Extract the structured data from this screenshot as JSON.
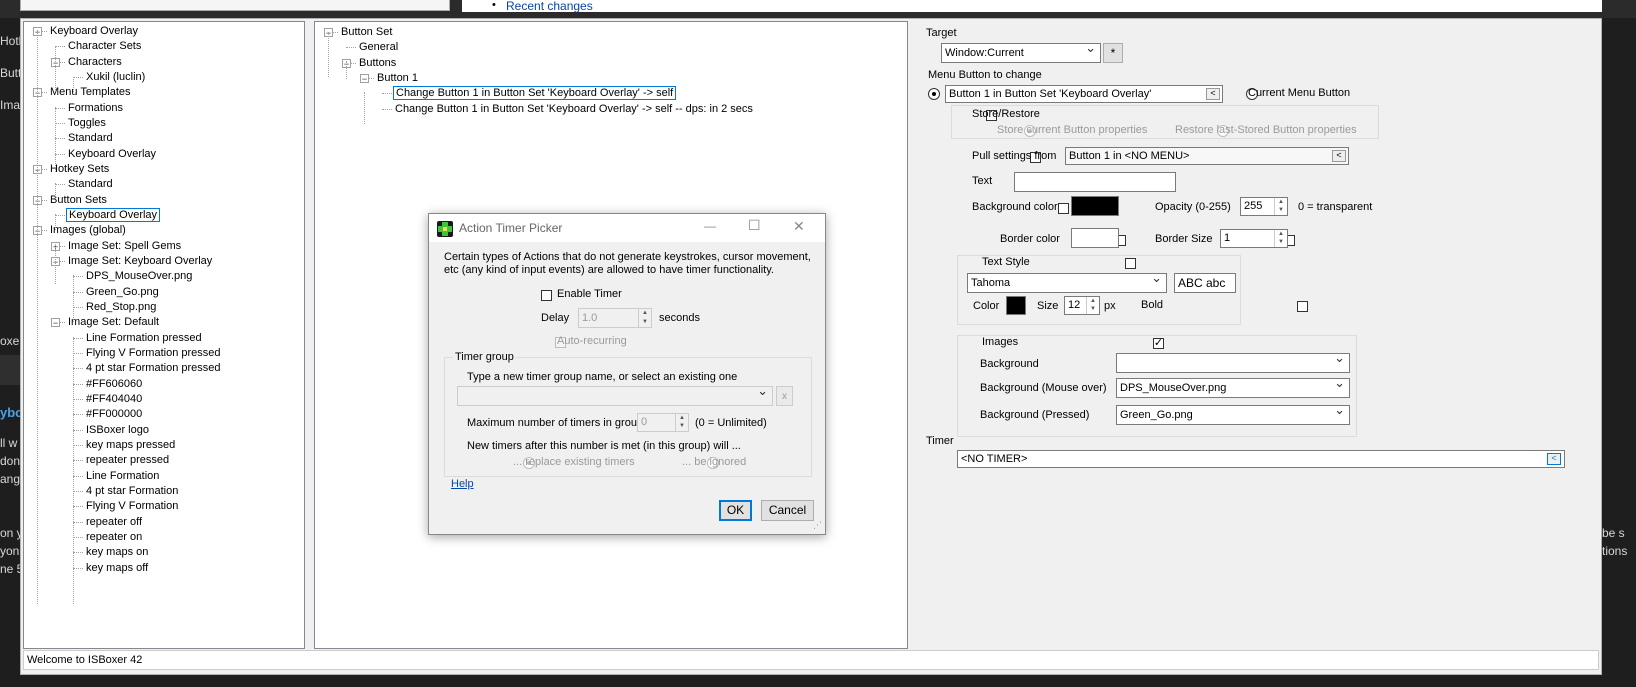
{
  "background": {
    "top_link": "Recent changes",
    "left_fragments": [
      "Hotk",
      "Butt",
      "Imag",
      "oxe",
      "ybo",
      "ll w",
      "don",
      "ang",
      "on y",
      "yon",
      "ne 5"
    ],
    "right_fragments": [
      "be s",
      "tions"
    ]
  },
  "left_tree": [
    {
      "label": "Keyboard Overlay",
      "level": 0,
      "toggle": "minus"
    },
    {
      "label": "Character Sets",
      "level": 1
    },
    {
      "label": "Characters",
      "level": 1,
      "toggle": "minus"
    },
    {
      "label": "Xukil (luclin)",
      "level": 2
    },
    {
      "label": "Menu Templates",
      "level": 0,
      "toggle": "minus"
    },
    {
      "label": "Formations",
      "level": 1
    },
    {
      "label": "Toggles",
      "level": 1
    },
    {
      "label": "Standard",
      "level": 1
    },
    {
      "label": "Keyboard Overlay",
      "level": 1
    },
    {
      "label": "Hotkey Sets",
      "level": 0,
      "toggle": "minus"
    },
    {
      "label": "Standard",
      "level": 1
    },
    {
      "label": "Button Sets",
      "level": 0,
      "toggle": "minus"
    },
    {
      "label": "Keyboard Overlay",
      "level": 1,
      "selected": true
    },
    {
      "label": "Images (global)",
      "level": 0,
      "toggle": "minus"
    },
    {
      "label": "Image Set: Spell Gems",
      "level": 1,
      "toggle": "plus"
    },
    {
      "label": "Image Set: Keyboard Overlay",
      "level": 1,
      "toggle": "minus"
    },
    {
      "label": "DPS_MouseOver.png",
      "level": 2
    },
    {
      "label": "Green_Go.png",
      "level": 2
    },
    {
      "label": "Red_Stop.png",
      "level": 2
    },
    {
      "label": "Image Set: Default",
      "level": 1,
      "toggle": "minus"
    },
    {
      "label": "Line Formation pressed",
      "level": 2
    },
    {
      "label": "Flying V Formation pressed",
      "level": 2
    },
    {
      "label": "4 pt star Formation pressed",
      "level": 2
    },
    {
      "label": "#FF606060",
      "level": 2
    },
    {
      "label": "#FF404040",
      "level": 2
    },
    {
      "label": "#FF000000",
      "level": 2
    },
    {
      "label": "ISBoxer logo",
      "level": 2
    },
    {
      "label": "key maps pressed",
      "level": 2
    },
    {
      "label": "repeater pressed",
      "level": 2
    },
    {
      "label": "Line Formation",
      "level": 2
    },
    {
      "label": "4 pt star Formation",
      "level": 2
    },
    {
      "label": "Flying V Formation",
      "level": 2
    },
    {
      "label": "repeater off",
      "level": 2
    },
    {
      "label": "repeater on",
      "level": 2
    },
    {
      "label": "key maps on",
      "level": 2
    },
    {
      "label": "key maps off",
      "level": 2
    }
  ],
  "middle_tree": [
    {
      "label": "Button Set",
      "level": 0,
      "toggle": "minus"
    },
    {
      "label": "General",
      "level": 1
    },
    {
      "label": "Buttons",
      "level": 1,
      "toggle": "minus"
    },
    {
      "label": "Button 1",
      "level": 2,
      "toggle": "minus"
    },
    {
      "label": "Change Button 1 in Button Set 'Keyboard Overlay' -> self",
      "level": 3,
      "selected": true
    },
    {
      "label": "Change Button 1 in Button Set 'Keyboard Overlay' -> self -- dps: in 2 secs",
      "level": 3
    }
  ],
  "right": {
    "target_label": "Target",
    "target_value": "Window:Current",
    "star": "*",
    "menu_button_label": "Menu Button to change",
    "menu_button_value": "Button 1 in Button Set 'Keyboard Overlay'",
    "current_menu_button": "Current Menu Button",
    "store_restore": "Store/Restore",
    "store_current": "Store current Button properties",
    "restore_last": "Restore last-Stored Button properties",
    "pull_settings": "Pull settings from",
    "pull_value": "Button 1 in <NO MENU>",
    "text_label": "Text",
    "text_value": "",
    "bg_color": "Background color",
    "bg_color_hex": "#000000",
    "opacity_label": "Opacity (0-255)",
    "opacity_value": "255",
    "opacity_hint": "0 = transparent",
    "border_color": "Border color",
    "border_color_hex": "#ffffff",
    "border_size_label": "Border Size",
    "border_size_value": "1",
    "text_style": "Text Style",
    "font_value": "Tahoma",
    "font_preview": "ABC abc",
    "color_label": "Color",
    "text_color_hex": "#000000",
    "size_label": "Size",
    "size_value": "12",
    "px": "px",
    "bold": "Bold",
    "images_label": "Images",
    "background_label": "Background",
    "background_value": "",
    "bg_mouseover_label": "Background (Mouse over)",
    "bg_mouseover_value": "DPS_MouseOver.png",
    "bg_pressed_label": "Background (Pressed)",
    "bg_pressed_value": "Green_Go.png",
    "timer_label": "Timer",
    "timer_value": "<NO TIMER>",
    "mini_button": "<"
  },
  "dialog": {
    "title": "Action Timer Picker",
    "description": "Certain types of Actions that do not generate keystrokes, cursor movement, etc (any kind of input events) are allowed to have timer functionality.",
    "enable_timer": "Enable Timer",
    "delay_label": "Delay",
    "delay_value": "1.0",
    "seconds": "seconds",
    "auto_recurring": "Auto-recurring",
    "timer_group": "Timer group",
    "group_hint": "Type a new timer group name, or select an existing one",
    "group_value": "",
    "clear_button": "x",
    "max_label": "Maximum number of timers in group",
    "max_value": "0",
    "max_hint": "(0 = Unlimited)",
    "new_timers_label": "New timers after this number is met (in this group) will ...",
    "replace": "... replace existing timers",
    "ignored": "... be ignored",
    "help": "Help",
    "ok": "OK",
    "cancel": "Cancel",
    "minimize": "—",
    "maximize": "☐",
    "close": "✕"
  },
  "status_bar": "Welcome to ISBoxer 42"
}
